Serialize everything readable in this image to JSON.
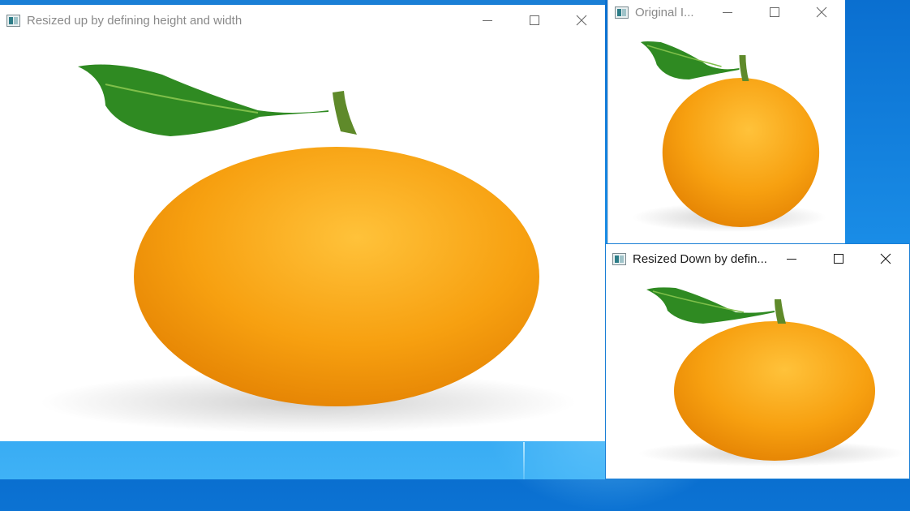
{
  "desktop": {
    "background_color": "#1b8fe8"
  },
  "windows": [
    {
      "id": "resized-up",
      "title": "Resized up by defining height and width",
      "active": false,
      "controls": {
        "minimize": "minimize-icon",
        "maximize": "maximize-icon",
        "close": "close-icon"
      },
      "image": "orange-with-leaf"
    },
    {
      "id": "original",
      "title": "Original I...",
      "active": false,
      "controls": {
        "minimize": "minimize-icon",
        "maximize": "maximize-icon",
        "close": "close-icon"
      },
      "image": "orange-with-leaf"
    },
    {
      "id": "resized-down",
      "title": "Resized Down by defin...",
      "active": true,
      "controls": {
        "minimize": "minimize-icon",
        "maximize": "maximize-icon",
        "close": "close-icon"
      },
      "image": "orange-with-leaf"
    }
  ],
  "colors": {
    "orange": "#f59a0c",
    "leaf": "#2f8a22",
    "titlebar_border": "#1a7fd6"
  }
}
